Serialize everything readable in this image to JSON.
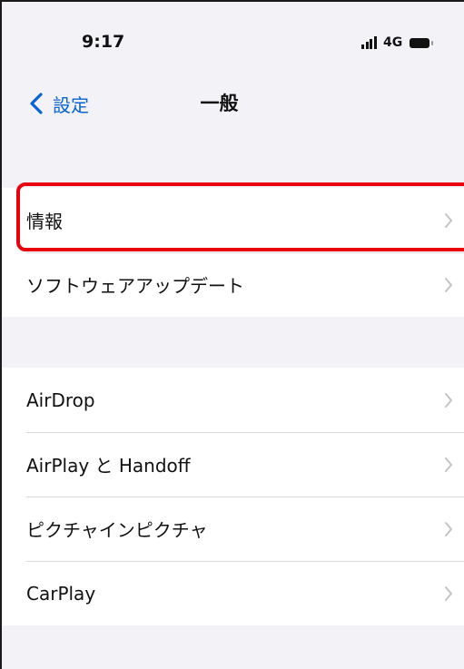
{
  "status_bar": {
    "time": "9:17",
    "network": "4G",
    "signal_icon": "cellular-signal-icon",
    "battery_icon": "battery-icon"
  },
  "nav": {
    "back_label": "設定",
    "back_icon": "chevron-left-icon",
    "title": "一般"
  },
  "groups": [
    {
      "items": [
        {
          "label": "情報",
          "icon": "chevron-right-icon",
          "highlighted": true
        },
        {
          "label": "ソフトウェアアップデート",
          "icon": "chevron-right-icon"
        }
      ]
    },
    {
      "items": [
        {
          "label": "AirDrop",
          "icon": "chevron-right-icon"
        },
        {
          "label": "AirPlay と Handoff",
          "icon": "chevron-right-icon"
        },
        {
          "label": "ピクチャインピクチャ",
          "icon": "chevron-right-icon"
        },
        {
          "label": "CarPlay",
          "icon": "chevron-right-icon"
        }
      ]
    }
  ],
  "colors": {
    "accent": "#0a63d6",
    "background": "#f2f2f7",
    "highlight": "#e8000f",
    "chevron": "#c4c4c7"
  }
}
